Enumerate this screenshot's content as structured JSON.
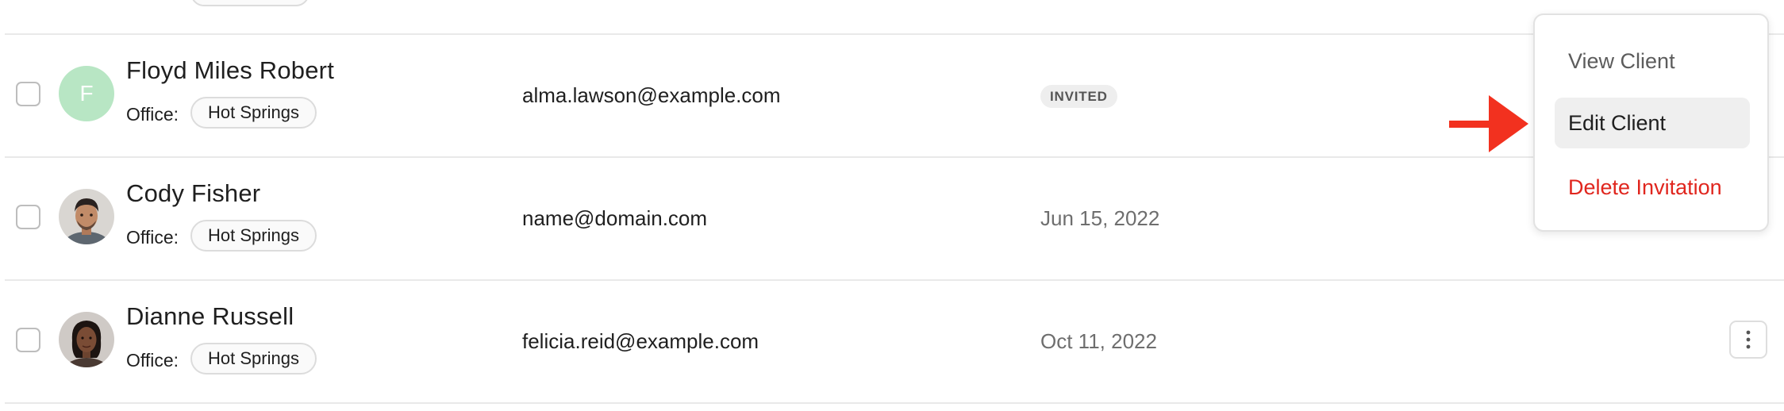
{
  "rows": [
    {
      "name": "Floyd Miles Robert",
      "avatar_initial": "F",
      "office_label": "Office:",
      "office": "Hot Springs",
      "email": "alma.lawson@example.com",
      "status": "INVITED"
    },
    {
      "name": "Cody Fisher",
      "office_label": "Office:",
      "office": "Hot Springs",
      "email": "name@domain.com",
      "date": "Jun 15, 2022"
    },
    {
      "name": "Dianne Russell",
      "office_label": "Office:",
      "office": "Hot Springs",
      "email": "felicia.reid@example.com",
      "date": "Oct 11, 2022"
    }
  ],
  "menu": {
    "items": [
      {
        "label": "View Client"
      },
      {
        "label": "Edit Client"
      },
      {
        "label": "Delete Invitation"
      }
    ],
    "highlighted": "Edit Client"
  },
  "colors": {
    "avatar_initial_bg": "#b8e6c4",
    "delete_text": "#e0261e",
    "annotation_arrow": "#f2311f",
    "divider": "#e9e9e9"
  },
  "icons": {
    "row_menu": "more-vertical-icon",
    "annotation": "arrow-right-icon"
  }
}
